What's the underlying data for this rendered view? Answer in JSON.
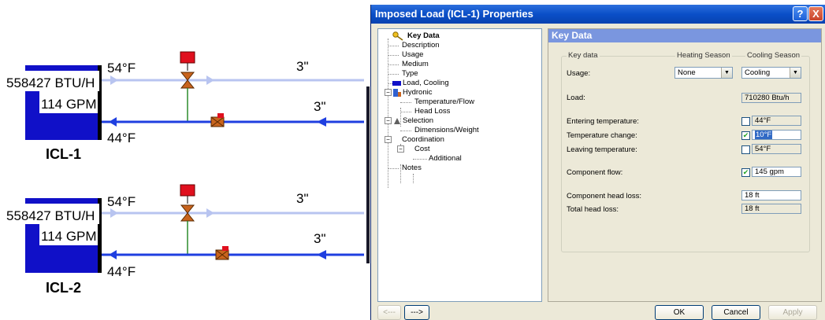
{
  "schematic": {
    "units": [
      {
        "name": "ICL-1",
        "load": "558427 BTU/H",
        "flow": "114 GPM",
        "supply_temp": "54°F",
        "return_temp": "44°F",
        "upper_pipe_size": "3\"",
        "lower_pipe_size": "3\""
      },
      {
        "name": "ICL-2",
        "load": "558427 BTU/H",
        "flow": "114 GPM",
        "supply_temp": "54°F",
        "return_temp": "44°F",
        "upper_pipe_size": "3\"",
        "lower_pipe_size": "3\""
      }
    ],
    "colors": {
      "unit_fill": "#1010c8",
      "supply_pipe": "#b8c4f0",
      "return_pipe": "#1f3fe0",
      "valve_actuator": "#e0101e",
      "valve_body": "#c8641e",
      "bypass_line": "#2a8a2a"
    }
  },
  "dialog": {
    "title": "Imposed Load (ICL-1) Properties",
    "help_label": "?",
    "close_label": "X",
    "tree": [
      {
        "label": "Key Data",
        "selected": true
      },
      {
        "label": "Description"
      },
      {
        "label": "Usage"
      },
      {
        "label": "Medium"
      },
      {
        "label": "Type"
      },
      {
        "label": "Load, Cooling"
      },
      {
        "label": "Hydronic"
      },
      {
        "label": "Temperature/Flow"
      },
      {
        "label": "Head Loss"
      },
      {
        "label": "Selection"
      },
      {
        "label": "Dimensions/Weight"
      },
      {
        "label": "Coordination"
      },
      {
        "label": "Cost"
      },
      {
        "label": "Additional"
      },
      {
        "label": "Notes"
      }
    ],
    "section_title": "Key Data",
    "group_label": "Key data",
    "heating_header": "Heating Season",
    "cooling_header": "Cooling Season",
    "usage": {
      "label": "Usage:",
      "heating_value": "None",
      "cooling_value": "Cooling"
    },
    "load": {
      "label": "Load:",
      "value": "710280 Btu/h"
    },
    "entering_temperature": {
      "label": "Entering temperature:",
      "value": "44°F",
      "checked": false
    },
    "temperature_change": {
      "label": "Temperature change:",
      "value": "10°F",
      "checked": true
    },
    "leaving_temperature": {
      "label": "Leaving temperature:",
      "value": "54°F",
      "checked": false
    },
    "component_flow": {
      "label": "Component flow:",
      "value": "145 gpm",
      "checked": true
    },
    "component_head_loss": {
      "label": "Component head loss:",
      "value": "18 ft"
    },
    "total_head_loss": {
      "label": "Total head loss:",
      "value": "18 ft"
    },
    "buttons": {
      "back": "<---",
      "forward": "--->",
      "ok": "OK",
      "cancel": "Cancel",
      "apply": "Apply"
    },
    "colors": {
      "titlebar": "#0a4fc8",
      "section_header": "#7a96df",
      "face": "#ece9d8"
    }
  }
}
